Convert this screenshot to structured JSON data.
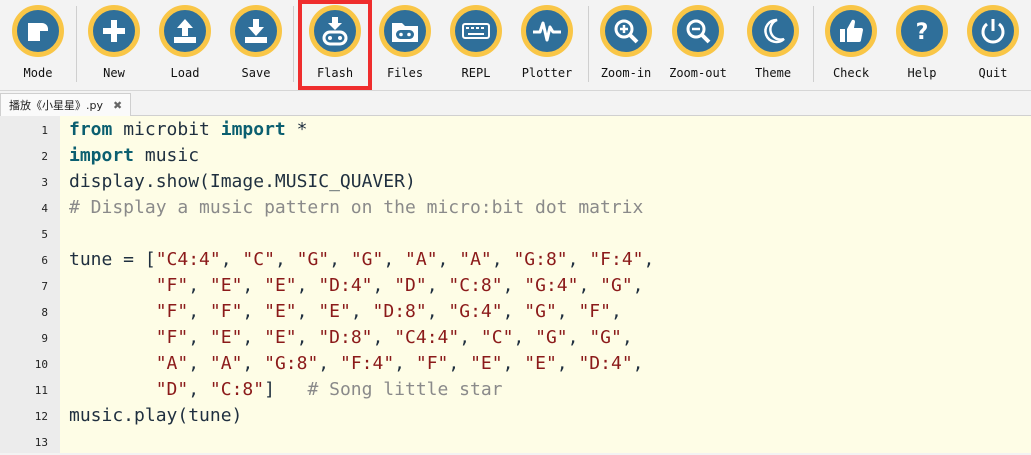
{
  "toolbar": {
    "buttons": [
      {
        "label": "Mode",
        "icon": "mode-icon"
      },
      {
        "label": "New",
        "icon": "plus-icon"
      },
      {
        "label": "Load",
        "icon": "upload-icon"
      },
      {
        "label": "Save",
        "icon": "download-icon"
      },
      {
        "label": "Flash",
        "icon": "microbit-flash-icon",
        "highlighted": true
      },
      {
        "label": "Files",
        "icon": "files-icon"
      },
      {
        "label": "REPL",
        "icon": "keyboard-icon"
      },
      {
        "label": "Plotter",
        "icon": "pulse-icon"
      },
      {
        "label": "Zoom-in",
        "icon": "zoom-in-icon"
      },
      {
        "label": "Zoom-out",
        "icon": "zoom-out-icon"
      },
      {
        "label": "Theme",
        "icon": "moon-icon"
      },
      {
        "label": "Check",
        "icon": "thumbs-up-icon"
      },
      {
        "label": "Help",
        "icon": "question-icon"
      },
      {
        "label": "Quit",
        "icon": "power-icon"
      }
    ],
    "highlight_color": "#ef2d2d"
  },
  "tab": {
    "filename": "播放《小星星》.py",
    "close_label": "✖"
  },
  "editor": {
    "lines": [
      {
        "n": "1",
        "text": "from microbit import *"
      },
      {
        "n": "2",
        "text": "import music"
      },
      {
        "n": "3",
        "text": "display.show(Image.MUSIC_QUAVER)"
      },
      {
        "n": "4",
        "text": "# Display a music pattern on the micro:bit dot matrix"
      },
      {
        "n": "5",
        "text": ""
      },
      {
        "n": "6",
        "text": "tune = [\"C4:4\", \"C\", \"G\", \"G\", \"A\", \"A\", \"G:8\", \"F:4\","
      },
      {
        "n": "7",
        "text": "        \"F\", \"E\", \"E\", \"D:4\", \"D\", \"C:8\", \"G:4\", \"G\","
      },
      {
        "n": "8",
        "text": "        \"F\", \"F\", \"E\", \"E\", \"D:8\", \"G:4\", \"G\", \"F\","
      },
      {
        "n": "9",
        "text": "        \"F\", \"E\", \"E\", \"D:8\", \"C4:4\", \"C\", \"G\", \"G\","
      },
      {
        "n": "10",
        "text": "        \"A\", \"A\", \"G:8\", \"F:4\", \"F\", \"E\", \"E\", \"D:4\","
      },
      {
        "n": "11",
        "text": "        \"D\", \"C:8\"]   # Song little star"
      },
      {
        "n": "12",
        "text": "music.play(tune)"
      },
      {
        "n": "13",
        "text": ""
      }
    ]
  }
}
